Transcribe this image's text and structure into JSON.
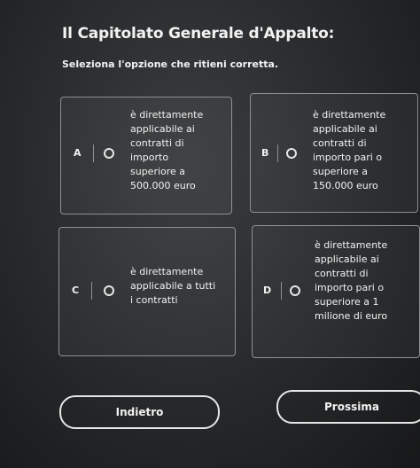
{
  "page": {
    "title": "Il Capitolato Generale d'Appalto:",
    "subtitle": "Seleziona l'opzione che ritieni corretta."
  },
  "options": [
    {
      "letter": "A",
      "text": "è direttamente\napplicabile ai\ncontratti di\nimporto\nsuperiore a\n500.000 euro"
    },
    {
      "letter": "B",
      "text": "è direttamente\napplicabile ai\ncontratti di\nimporto pari o\nsuperiore a\n150.000 euro"
    },
    {
      "letter": "C",
      "text": "è direttamente\napplicabile a tutti\ni contratti"
    },
    {
      "letter": "D",
      "text": "è direttamente\napplicabile ai\ncontratti di\nimporto pari o\nsuperiore a 1\nmilione di euro"
    }
  ],
  "buttons": {
    "back_label": "Indietro",
    "next_label": "Prossima"
  }
}
